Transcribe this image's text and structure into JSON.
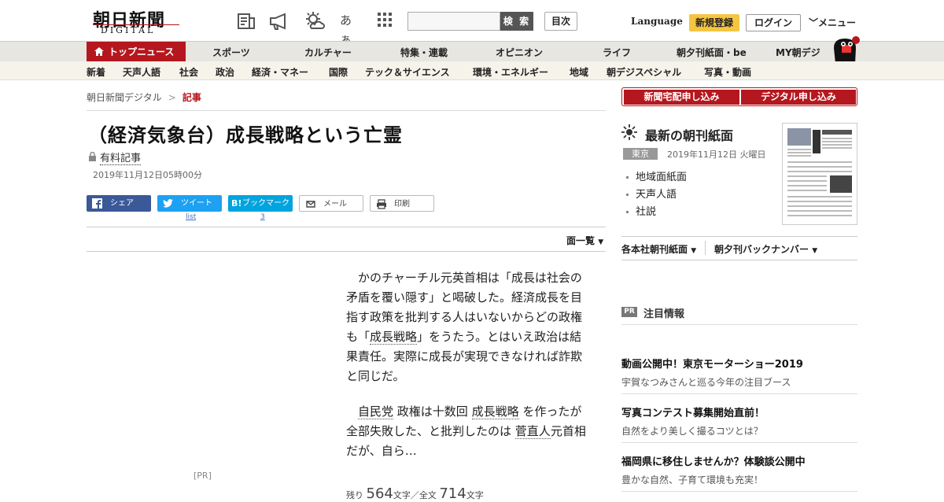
{
  "header": {
    "logo_main": "朝日新聞",
    "logo_sub": "DIGITAL",
    "icons": [
      "newspaper-icon",
      "megaphone-icon",
      "weather-icon",
      "font-size-icon",
      "apps-grid-icon"
    ],
    "font_icon_text": "あぁ",
    "search_placeholder": "",
    "search_button": "検 索",
    "toc_button": "目次",
    "language": "Language",
    "register": "新規登録",
    "login": "ログイン",
    "menu": "メニュー"
  },
  "nav_main": {
    "active": "トップニュース",
    "items": [
      "スポーツ",
      "カルチャー",
      "特集・連載",
      "オピニオン",
      "ライフ",
      "朝夕刊紙面・be",
      "MY朝デジ"
    ]
  },
  "nav_sub": {
    "items": [
      "新着",
      "天声人語",
      "社会",
      "政治",
      "経済・マネー",
      "国際",
      "テック＆サイエンス",
      "環境・エネルギー",
      "地域",
      "朝デジスペシャル",
      "写真・動画"
    ]
  },
  "breadcrumb": {
    "home": "朝日新聞デジタル",
    "sep": ">",
    "current": "記事"
  },
  "article": {
    "title": "（経済気象台）成長戦略という亡霊",
    "paid_label": "有料記事",
    "date": "2019年11月12日05時00分",
    "share": {
      "facebook": "シェア",
      "twitter": "ツイート",
      "twitter_count": "list",
      "hatena": "ブックマーク",
      "hatena_count": "3",
      "mail": "メール",
      "print": "印刷"
    },
    "page_list": "面一覧",
    "pr_label": "[PR]",
    "para1_a": "かのチャーチル元英首相は「成長は社会の矛盾を覆い隠す」と喝破した。経済成長を目指す政策を批判する人はいないからどの政権も「",
    "para1_link": "成長戦略",
    "para1_b": "」をうたう。とはいえ政治は結果責任。実際に成長が実現できなければ詐欺と同じだ。",
    "para2_link1": "自民党",
    "para2_a": "政権は十数回",
    "para2_link2": "成長戦略",
    "para2_b": "を作ったが全部失敗した、と批判したのは",
    "para2_link3": "菅直人",
    "para2_c": "元首相だが、自ら…",
    "count_label1": "残り",
    "count_num1": "564",
    "count_unit1": "文字／全文",
    "count_num2": "714",
    "count_unit2": "文字"
  },
  "sidebar": {
    "sub_home": "新聞宅配申し込み",
    "sub_digital": "デジタル申し込み",
    "paper_title": "最新の朝刊紙面",
    "region": "東京",
    "paper_date": "2019年11月12日 火曜日",
    "paper_links": [
      "地域面紙面",
      "天声人語",
      "社説"
    ],
    "dd_regional": "各本社朝刊紙面",
    "dd_backnumber": "朝夕刊バックナンバー",
    "pr_badge": "PR",
    "pr_title": "注目情報",
    "pr_items": [
      {
        "headline": "動画公開中！東京モーターショー2019",
        "sub": "宇賀なつみさんと巡る今年の注目ブース"
      },
      {
        "headline": "写真コンテスト募集開始直前！",
        "sub": "自然をより美しく撮るコツとは？"
      },
      {
        "headline": "福岡県に移住しませんか？体験談公開中",
        "sub": "豊かな自然、子育て環境も充実！"
      }
    ]
  },
  "colors": {
    "brand_red": "#b5171e",
    "register_yellow": "#f5c542",
    "facebook": "#3b5998",
    "twitter": "#1da1f2",
    "hatena": "#00a4de"
  }
}
